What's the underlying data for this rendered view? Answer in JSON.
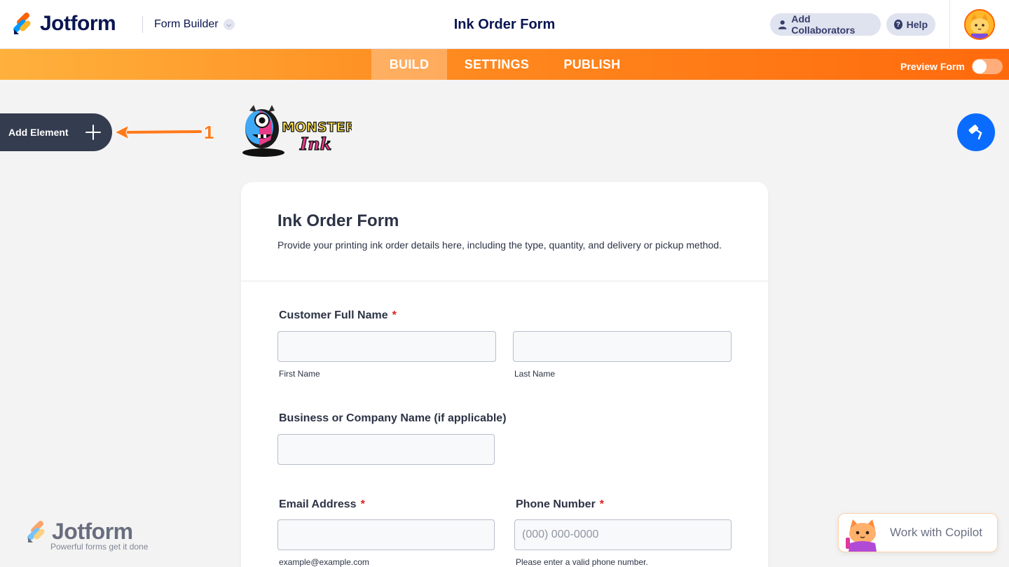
{
  "app": {
    "logo_text": "Jotform",
    "builder_label": "Form Builder",
    "form_title": "Ink Order Form",
    "collab_label": "Add Collaborators",
    "help_label": "Help"
  },
  "nav": {
    "tabs": [
      {
        "label": "BUILD",
        "active": true
      },
      {
        "label": "SETTINGS",
        "active": false
      },
      {
        "label": "PUBLISH",
        "active": false
      }
    ],
    "preview_label": "Preview Form",
    "preview_on": false
  },
  "sidebar": {
    "add_element_label": "Add Element",
    "annotation_number": "1"
  },
  "brand": {
    "logo_text_line1": "MONSTERS",
    "logo_text_line2": "Ink"
  },
  "form": {
    "title": "Ink Order Form",
    "description": "Provide your printing ink order details here, including the type, quantity, and delivery or pickup method.",
    "fields": {
      "full_name": {
        "label": "Customer Full Name",
        "required_mark": "*",
        "first_sublabel": "First Name",
        "last_sublabel": "Last Name",
        "first_value": "",
        "last_value": ""
      },
      "company": {
        "label": "Business or Company Name (if applicable)",
        "value": ""
      },
      "email": {
        "label": "Email Address",
        "required_mark": "*",
        "value": "",
        "sublabel": "example@example.com"
      },
      "phone": {
        "label": "Phone Number",
        "required_mark": "*",
        "placeholder": "(000) 000-0000",
        "sublabel": "Please enter a valid phone number."
      }
    }
  },
  "watermark": {
    "logo_text": "Jotform",
    "tagline": "Powerful forms get it done"
  },
  "copilot": {
    "label": "Work with Copilot"
  },
  "colors": {
    "brand_navy": "#0a1551",
    "nav_orange_start": "#ffb13d",
    "nav_orange_end": "#ff6a0d",
    "accent_blue": "#0a6cff",
    "required_red": "#e11d1d"
  }
}
